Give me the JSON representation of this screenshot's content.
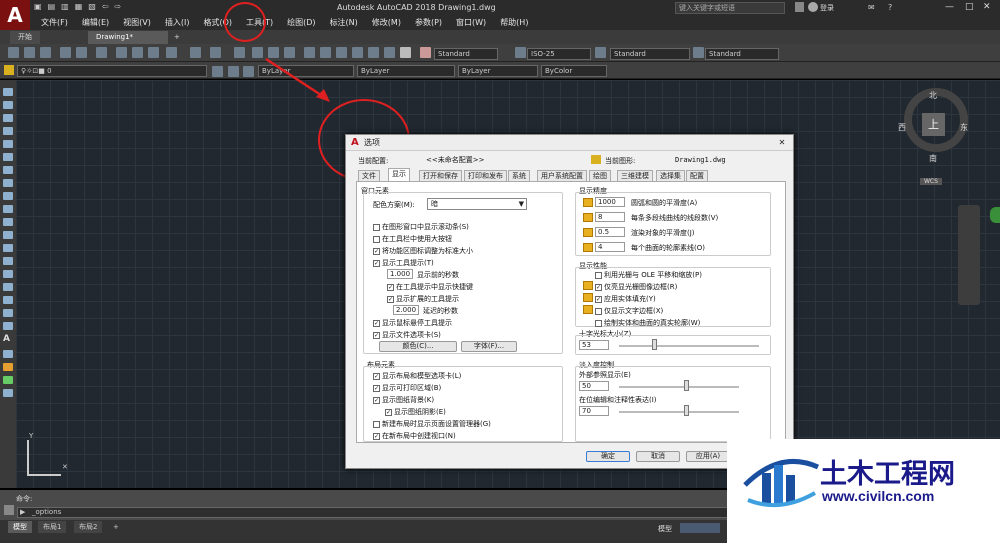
{
  "app": {
    "logo": "A",
    "window_title": "Autodesk AutoCAD 2018    Drawing1.dwg",
    "search_placeholder": "键入关键字或短语",
    "login": "登录"
  },
  "quick_access": [
    "▣",
    "▤",
    "▥",
    "▦",
    "▧",
    "⇦",
    "⇨"
  ],
  "menu": [
    "文件(F)",
    "编辑(E)",
    "视图(V)",
    "插入(I)",
    "格式(O)",
    "工具(T)",
    "绘图(D)",
    "标注(N)",
    "修改(M)",
    "参数(P)",
    "窗口(W)",
    "帮助(H)"
  ],
  "doc_tabs": [
    "开始",
    "Drawing1*",
    "+"
  ],
  "toolbar": {
    "text_style": "Standard",
    "dim_style": "ISO-25",
    "table_style": "Standard",
    "mleader_style": "Standard"
  },
  "layers": {
    "current_layer": "0",
    "color": "ByLayer",
    "linetype": "ByLayer",
    "lineweight": "ByLayer",
    "plotstyle": "ByColor"
  },
  "viewcube": {
    "north": "北",
    "south": "南",
    "west": "西",
    "east": "东",
    "top": "上",
    "wcs": "WCS"
  },
  "command": {
    "label": "命令:",
    "input": "_options",
    "prompt_icon": "▶"
  },
  "sheets": [
    "模型",
    "布局1",
    "布局2",
    "+"
  ],
  "status": {
    "model": "模型"
  },
  "dialog": {
    "title": "选项",
    "close": "✕",
    "current_profile_label": "当前配置:",
    "current_profile": "<<未命名配置>>",
    "current_drawing_label": "当前图形:",
    "current_drawing": "Drawing1.dwg",
    "tabs": [
      "文件",
      "显示",
      "打开和保存",
      "打印和发布",
      "系统",
      "用户系统配置",
      "绘图",
      "三维建模",
      "选择集",
      "配置"
    ],
    "window_elements": {
      "title": "窗口元素",
      "color_scheme_label": "配色方案(M):",
      "color_scheme": "暗",
      "items": [
        {
          "label": "在图形窗口中显示滚动条(S)",
          "checked": false
        },
        {
          "label": "在工具栏中使用大按钮",
          "checked": false
        },
        {
          "label": "将功能区图标调整为标准大小",
          "checked": true
        },
        {
          "label": "显示工具提示(T)",
          "checked": true
        }
      ],
      "tooltip_delay": "1.000",
      "tooltip_delay_label": "显示前的秒数",
      "sub_items": [
        {
          "label": "在工具提示中显示快捷键",
          "checked": true
        },
        {
          "label": "显示扩展的工具提示",
          "checked": true
        }
      ],
      "ext_delay": "2.000",
      "ext_delay_label": "延迟的秒数",
      "items2": [
        {
          "label": "显示鼠标悬停工具提示",
          "checked": true
        },
        {
          "label": "显示文件选项卡(S)",
          "checked": true
        }
      ],
      "colors_btn": "颜色(C)...",
      "fonts_btn": "字体(F)..."
    },
    "layout_elements": {
      "title": "布局元素",
      "items": [
        {
          "label": "显示布局和模型选项卡(L)",
          "checked": true
        },
        {
          "label": "显示可打印区域(B)",
          "checked": true
        },
        {
          "label": "显示图纸背景(K)",
          "checked": true
        },
        {
          "label": "显示图纸阴影(E)",
          "checked": true
        },
        {
          "label": "新建布局时显示页面设置管理器(G)",
          "checked": false
        },
        {
          "label": "在新布局中创建视口(N)",
          "checked": true
        }
      ]
    },
    "resolution": {
      "title": "显示精度",
      "items": [
        {
          "value": "1000",
          "label": "圆弧和圆的平滑度(A)"
        },
        {
          "value": "8",
          "label": "每条多段线曲线的线段数(V)"
        },
        {
          "value": "0.5",
          "label": "渲染对象的平滑度(J)"
        },
        {
          "value": "4",
          "label": "每个曲面的轮廓素线(O)"
        }
      ]
    },
    "performance": {
      "title": "显示性能",
      "items": [
        {
          "label": "利用光栅与 OLE 平移和缩放(P)",
          "checked": false
        },
        {
          "label": "仅亮显光栅图像边框(R)",
          "checked": true
        },
        {
          "label": "应用实体填充(Y)",
          "checked": true
        },
        {
          "label": "仅显示文字边框(X)",
          "checked": false
        },
        {
          "label": "绘制实体和曲面的真实轮廓(W)",
          "checked": false
        }
      ]
    },
    "crosshair": {
      "title": "十字光标大小(Z)",
      "value": "53",
      "fraction": 0.25
    },
    "fade": {
      "title": "淡入度控制",
      "xref_label": "外部参照显示(E)",
      "xref_value": "50",
      "xref_fraction": 0.56,
      "inplace_label": "在位编辑和注释性表达(I)",
      "inplace_value": "70",
      "inplace_fraction": 0.56
    },
    "buttons": {
      "ok": "确定",
      "cancel": "取消",
      "apply": "应用(A)"
    }
  },
  "watermark": {
    "name": "土木工程网",
    "url": "www.civilcn.com"
  }
}
